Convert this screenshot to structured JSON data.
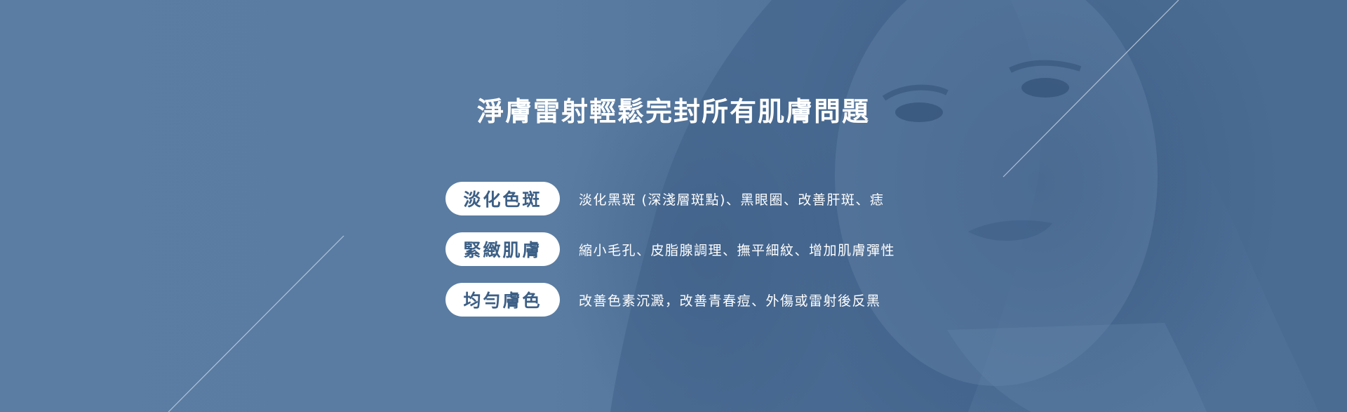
{
  "headline": "淨膚雷射輕鬆完封所有肌膚問題",
  "benefits": [
    {
      "label": "淡化色斑",
      "description": "淡化黑斑 (深淺層斑點)、黑眼圈、改善肝斑、痣"
    },
    {
      "label": "緊緻肌膚",
      "description": "縮小毛孔、皮脂腺調理、撫平細紋、增加肌膚彈性"
    },
    {
      "label": "均勻膚色",
      "description": "改善色素沉澱，改善青春痘、外傷或雷射後反黑"
    }
  ],
  "colors": {
    "background": "#5a7ca2",
    "pill_background": "#ffffff",
    "pill_text": "#3c5f86",
    "text": "#ffffff"
  }
}
